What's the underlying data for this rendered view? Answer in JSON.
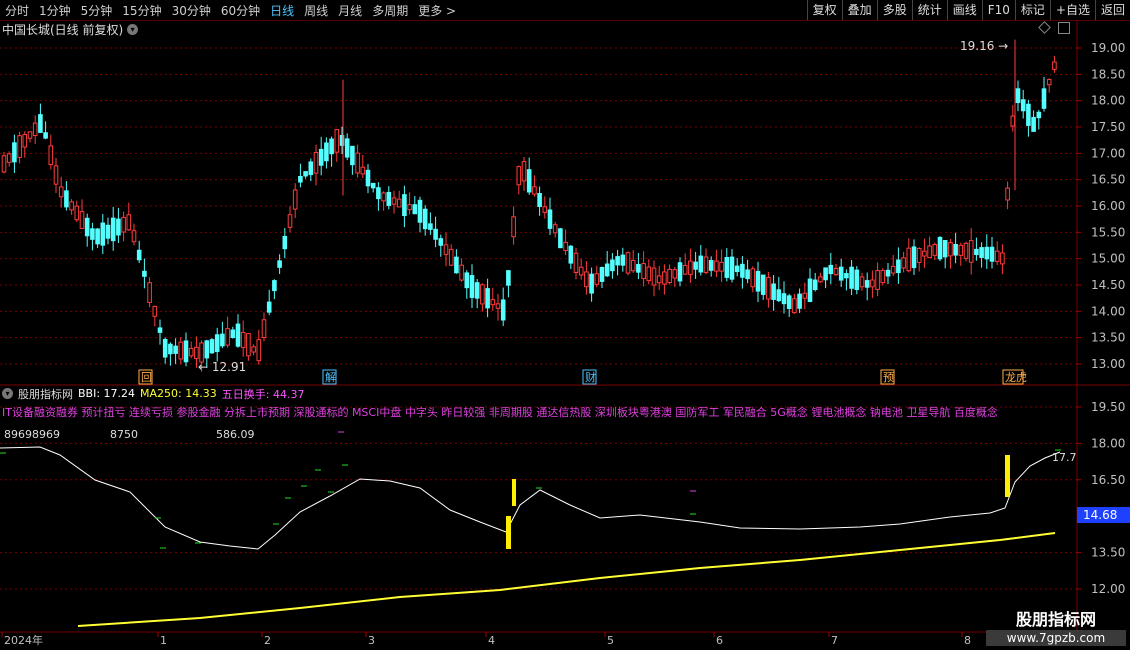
{
  "toolbar": {
    "periods": [
      "分时",
      "1分钟",
      "5分钟",
      "15分钟",
      "30分钟",
      "60分钟",
      "日线",
      "周线",
      "月线",
      "多周期",
      "更多 >"
    ],
    "active_period": "日线",
    "tools": [
      "复权",
      "叠加",
      "多股",
      "统计",
      "画线",
      "F10",
      "标记",
      "+自选",
      "返回"
    ]
  },
  "chart_title": "中国长城(日线 前复权)",
  "main_axis": {
    "labels": [
      "19.00",
      "18.50",
      "18.00",
      "17.50",
      "17.00",
      "16.50",
      "16.00",
      "15.50",
      "15.00",
      "14.50",
      "14.00",
      "13.50",
      "13.00"
    ]
  },
  "annotations": {
    "high": "19.16",
    "low": "12.91"
  },
  "markers": [
    "回",
    "解",
    "财",
    "预",
    "龙虎"
  ],
  "indicator": {
    "name": "股朋指标网",
    "bbi": "BBI: 17.24",
    "ma250": "MA250: 14.33",
    "turnover": "五日换手: 44.37",
    "concepts": "IT设备融资融券 预计扭亏 连续亏损 参股金融 分拆上市预期 深股通标的 MSCI中盘 中字头 昨日较强 非周期股 通达信热股 深圳板块粤港澳 国防军工 军民融合 5G概念 锂电池概念 钠电池 卫星导航 百度概念",
    "num1": "89698969",
    "num2": "8750",
    "num3": "586.09",
    "end_value": "17.7",
    "price_tag": "14.68"
  },
  "sub_axis": {
    "labels": [
      "19.50",
      "18.00",
      "16.50",
      "13.50",
      "12.00"
    ]
  },
  "time_axis": {
    "labels": [
      "2024年",
      "1",
      "2",
      "3",
      "4",
      "5",
      "6",
      "7",
      "8"
    ]
  },
  "watermark": {
    "title": "股朋指标网",
    "url": "www.7gpzb.com"
  },
  "colors": {
    "up": "#ff3b3b",
    "down": "#54ffff",
    "bbi": "#ffffff",
    "ma250": "#ffff33",
    "grid": "#7a0000"
  }
}
